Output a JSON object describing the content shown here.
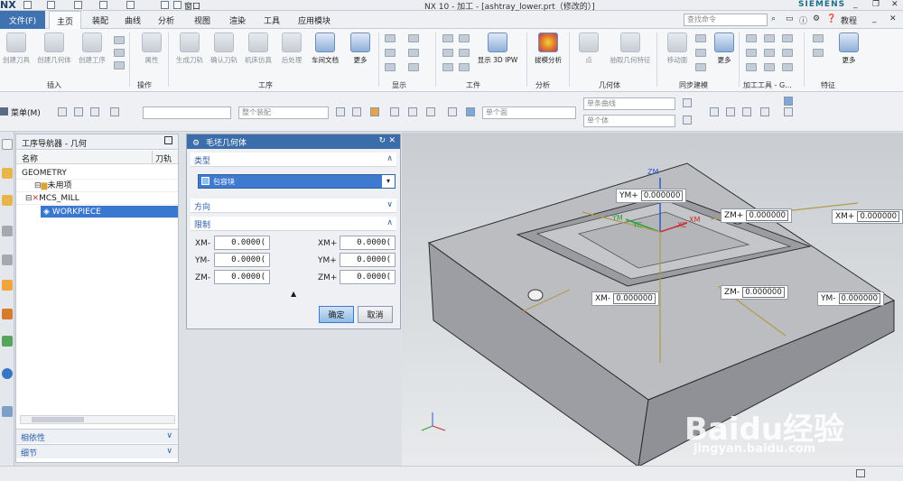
{
  "titlebar": {
    "logo": "NX",
    "window_menu": "窗口",
    "title": "NX 10 - 加工 - [ashtray_lower.prt（修改的）]",
    "brand": "SIEMENS"
  },
  "menubar": {
    "file": "文件(F)",
    "tabs": [
      "主页",
      "装配",
      "曲线",
      "分析",
      "视图",
      "渲染",
      "工具",
      "应用模块"
    ],
    "search_placeholder": "查找命令",
    "tutorial": "教程"
  },
  "ribbon": {
    "buttons": [
      {
        "label": "创建刀具"
      },
      {
        "label": "创建几何体"
      },
      {
        "label": "创建工序"
      },
      {
        "label": "属性"
      },
      {
        "label": "生成刀轨"
      },
      {
        "label": "确认刀轨"
      },
      {
        "label": "机床仿真"
      },
      {
        "label": "后处理"
      },
      {
        "label": "车间文档"
      },
      {
        "label": "更多"
      },
      {
        "label": "显示 3D IPW"
      },
      {
        "label": "拔模分析"
      },
      {
        "label": "点"
      },
      {
        "label": "抽取几何特征"
      },
      {
        "label": "移动面"
      },
      {
        "label": "更多"
      },
      {
        "label": "更多"
      }
    ],
    "groups": [
      "插入",
      "操作",
      "工序",
      "显示",
      "工件",
      "分析",
      "几何体",
      "同步建模",
      "加工工具 - G...",
      "特征"
    ]
  },
  "toolbar": {
    "menu": "菜单(M)",
    "assembly_filter": "整个装配",
    "face_filter": "单个面",
    "curve_filter": "单条曲线",
    "body_filter": "单个体"
  },
  "navigator": {
    "title": "工序导航器 - 几何",
    "col_name": "名称",
    "col_path": "刀轨",
    "rows": [
      "GEOMETRY",
      "未用项",
      "MCS_MILL",
      "WORKPIECE"
    ],
    "dependencies": "相依性",
    "details": "细节"
  },
  "dialog": {
    "title": "毛坯几何体",
    "section_type": "类型",
    "type_value": "包容块",
    "section_direction": "方向",
    "section_limits": "限制",
    "limits": {
      "xm_minus_label": "XM-",
      "xm_minus": "0.0000(",
      "ym_minus_label": "YM-",
      "ym_minus": "0.0000(",
      "zm_minus_label": "ZM-",
      "zm_minus": "0.0000(",
      "xm_plus_label": "XM+",
      "xm_plus": "0.0000(",
      "ym_plus_label": "YM+",
      "ym_plus": "0.0000(",
      "zm_plus_label": "ZM+",
      "zm_plus": "0.0000("
    },
    "ok": "确定",
    "cancel": "取消"
  },
  "viewport": {
    "handles": [
      {
        "label": "YM+",
        "value": "0.000000"
      },
      {
        "label": "ZM+",
        "value": "0.000000"
      },
      {
        "label": "XM+",
        "value": "0.000000"
      },
      {
        "label": "XM-",
        "value": "0.000000"
      },
      {
        "label": "ZM-",
        "value": "0.000000"
      },
      {
        "label": "YM-",
        "value": "0.000000"
      }
    ],
    "axis_labels": {
      "zm": "ZM",
      "ym": "YM",
      "yc": "YC",
      "xc": "XC",
      "xm": "XM"
    }
  },
  "watermark": {
    "brand": "Baidu经验",
    "url": "jingyan.baidu.com"
  },
  "colors": {
    "accent": "#3a6da9",
    "select_blue": "#3d7ad0",
    "part_gray": "#a8a9ad"
  }
}
